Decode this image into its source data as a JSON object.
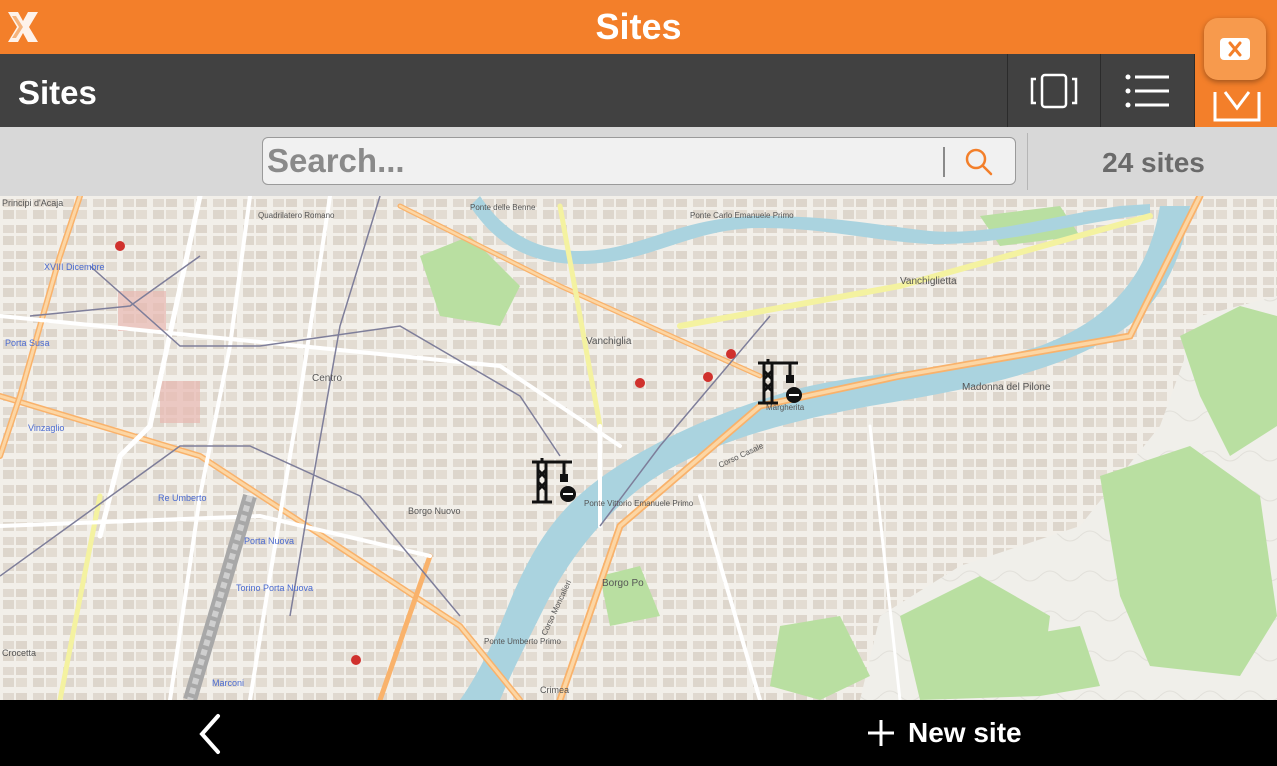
{
  "header": {
    "title": "Sites"
  },
  "toolbar": {
    "title": "Sites"
  },
  "search": {
    "placeholder": "Search...",
    "value": "",
    "count_label": "24 sites"
  },
  "map": {
    "labels": {
      "principi": "Principi d'Acaja",
      "porta_susa": "Porta Susa",
      "xviii": "XVIII Dicembre",
      "vinzaglio": "Vinzaglio",
      "re_umberto": "Re Umberto",
      "porta_nuova": "Porta Nuova",
      "torino_pn": "Torino Porta Nuova",
      "crocetta": "Crocetta",
      "marconi": "Marconi",
      "centro": "Centro",
      "borgo_nuovo": "Borgo Nuovo",
      "vanchiglia": "Vanchiglia",
      "vanchiglietta": "Vanchiglietta",
      "madonna": "Madonna del Pilone",
      "borgo_po": "Borgo Po",
      "crimea": "Crimea",
      "ponte_vittorio": "Ponte Vittorio Emanuele Primo",
      "ponte_umberto": "Ponte Umberto Primo",
      "margherita": "Margherita",
      "ponte_carlo": "Ponte Carlo Emanuele Primo",
      "ponte_dame": "Ponte delle Benne",
      "corso_casale": "Corso Casale",
      "corso_moncalieri": "Corso Moncalieri",
      "quadrilatero": "Quadrilatero Romano"
    }
  },
  "bottom": {
    "new_site_label": "New site"
  }
}
